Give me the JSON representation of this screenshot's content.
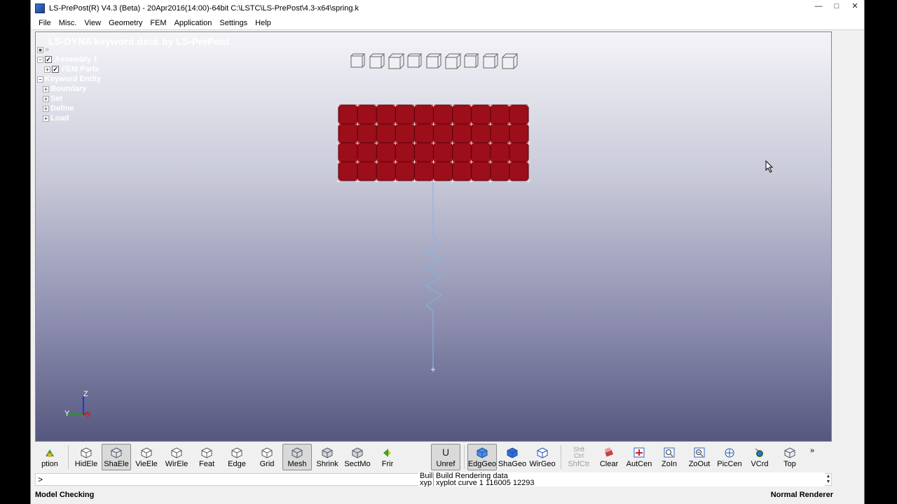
{
  "window": {
    "title": "LS-PrePost(R) V4.3 (Beta) - 20Apr2016(14:00)-64bit C:\\LSTC\\LS-PrePost\\4.3-x64\\spring.k",
    "controls": [
      "minimize-icon",
      "maximize-icon",
      "close-icon"
    ]
  },
  "menu": [
    "File",
    "Misc.",
    "View",
    "Geometry",
    "FEM",
    "Application",
    "Settings",
    "Help"
  ],
  "viewport": {
    "title": "LS-DYNA keyword deck by LS-PrePost",
    "tree": [
      {
        "label": "Assembly 1",
        "checked": true
      },
      {
        "label": "FEM Parts",
        "checked": true
      },
      {
        "label": "Keyword Entity"
      },
      {
        "label": "Boundary"
      },
      {
        "label": "Set"
      },
      {
        "label": "Define"
      },
      {
        "label": "Load"
      }
    ],
    "axes": {
      "z": "Z",
      "y": "Y",
      "x": "X"
    },
    "colors": {
      "mesh_fill": "#9b0e1a",
      "spring": "#7fb6e6",
      "node": "#ffffff"
    }
  },
  "toolbar": {
    "group1": [
      {
        "label": "ption",
        "icon": "options-icon",
        "pressed": false
      },
      {
        "label": "HidEle",
        "icon": "hidden-element-icon",
        "pressed": false
      },
      {
        "label": "ShaEle",
        "icon": "shaded-element-icon",
        "pressed": true
      },
      {
        "label": "VieEle",
        "icon": "view-element-icon",
        "pressed": false
      },
      {
        "label": "WirEle",
        "icon": "wire-element-icon",
        "pressed": false
      },
      {
        "label": "Feat",
        "icon": "feature-icon",
        "pressed": false
      },
      {
        "label": "Edge",
        "icon": "edge-icon",
        "pressed": false
      },
      {
        "label": "Grid",
        "icon": "grid-icon",
        "pressed": false
      },
      {
        "label": "Mesh",
        "icon": "mesh-icon",
        "pressed": true
      },
      {
        "label": "Shrink",
        "icon": "shrink-icon",
        "pressed": false
      },
      {
        "label": "SectMo",
        "icon": "section-mode-icon",
        "pressed": false
      },
      {
        "label": "Frir",
        "icon": "fringe-icon",
        "pressed": false
      }
    ],
    "group2": [
      {
        "label": "Unref",
        "icon": "unreferenced-icon",
        "pressed": true
      },
      {
        "label": "EdgGeo",
        "icon": "edge-geometry-icon",
        "pressed": true
      },
      {
        "label": "ShaGeo",
        "icon": "shaded-geometry-icon",
        "pressed": false
      },
      {
        "label": "WirGeo",
        "icon": "wire-geometry-icon",
        "pressed": false
      },
      {
        "label": "ShfCtr",
        "icon": "shift-ctrl-icon",
        "pressed": false,
        "disabled": true
      },
      {
        "label": "Clear",
        "icon": "clear-icon",
        "pressed": false
      },
      {
        "label": "AutCen",
        "icon": "auto-center-icon",
        "pressed": false
      },
      {
        "label": "ZoIn",
        "icon": "zoom-in-icon",
        "pressed": false
      },
      {
        "label": "ZoOut",
        "icon": "zoom-out-icon",
        "pressed": false
      },
      {
        "label": "PicCen",
        "icon": "pick-center-icon",
        "pressed": false
      },
      {
        "label": "VCrd",
        "icon": "view-coordinate-icon",
        "pressed": false
      },
      {
        "label": "Top",
        "icon": "top-view-icon",
        "pressed": false
      }
    ],
    "overflow": "»",
    "shift_ctrl_top": "Shft",
    "shift_ctrl_bottom": "Ctrl"
  },
  "command": {
    "prompt": ">",
    "history": [
      {
        "prefix": "Buil",
        "text": "Build Rendering data"
      },
      {
        "prefix": "xyp",
        "text": "xyplot curve 1 116005 12293"
      }
    ]
  },
  "status": {
    "left": "Model Checking",
    "right": "Normal Renderer"
  }
}
